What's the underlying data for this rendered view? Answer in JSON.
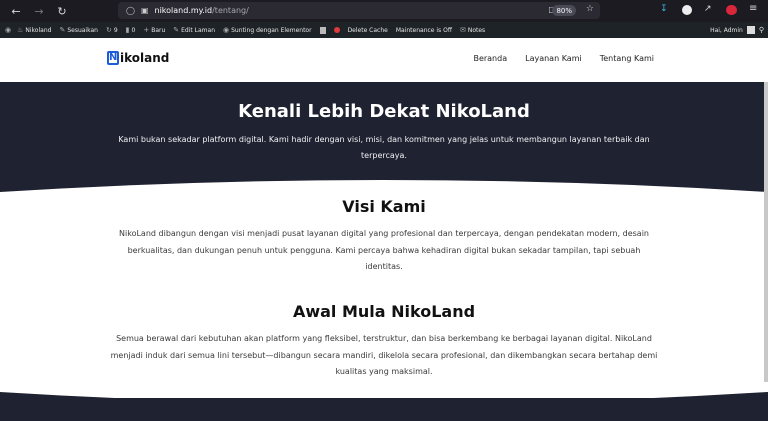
{
  "browser": {
    "url_host": "nikoland.my.id",
    "url_path": "/tentang/",
    "zoom": "80%"
  },
  "wp_admin": {
    "items": [
      "Nikoland",
      "Sesuaikan",
      "9",
      "0",
      "Baru",
      "Edit Laman",
      "Sunting dengan Elementor",
      "Delete Cache",
      "Maintenance is Off",
      "Notes"
    ],
    "greeting": "Hai, Admin"
  },
  "site": {
    "logo_letter": "N",
    "logo_rest": "ikoland",
    "menu": [
      "Beranda",
      "Layanan Kami",
      "Tentang Kami"
    ]
  },
  "hero": {
    "title": "Kenali Lebih Dekat NikoLand",
    "text": "Kami bukan sekadar platform digital. Kami hadir dengan visi, misi, dan komitmen yang jelas untuk membangun layanan terbaik dan terpercaya."
  },
  "visi": {
    "title": "Visi Kami",
    "text": "NikoLand dibangun dengan visi menjadi pusat layanan digital yang profesional dan terpercaya, dengan pendekatan modern, desain berkualitas, dan dukungan penuh untuk pengguna. Kami percaya bahwa kehadiran digital bukan sekadar tampilan, tapi sebuah identitas."
  },
  "awal": {
    "title": "Awal Mula NikoLand",
    "text": "Semua berawal dari kebutuhan akan platform yang fleksibel, terstruktur, dan bisa berkembang ke berbagai layanan digital. NikoLand menjadi induk dari semua lini tersebut—dibangun secara mandiri, dikelola secara profesional, dan dikembangkan secara bertahap demi kualitas yang maksimal."
  },
  "colors": {
    "dark": "#1f2230",
    "brand": "#1e5bd6"
  }
}
